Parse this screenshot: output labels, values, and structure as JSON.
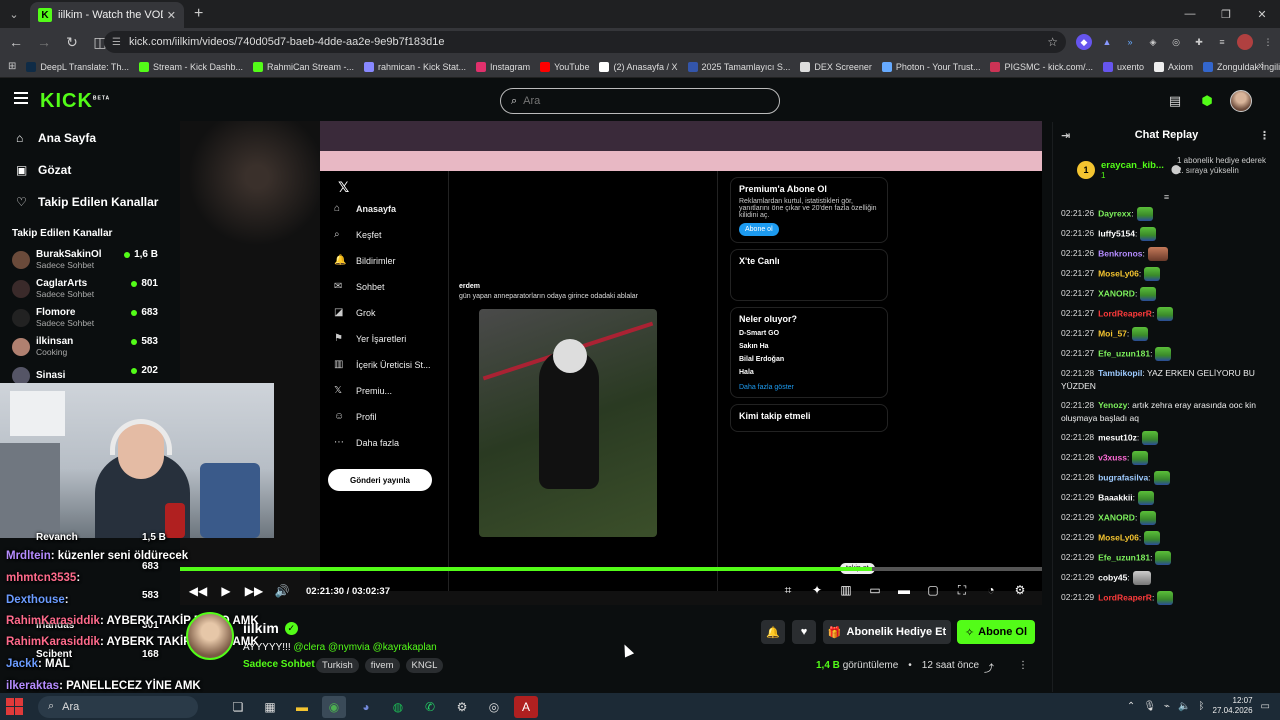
{
  "browser": {
    "tab_title": "iilkim - Watch the VOD on Kick",
    "tab_close": "✕",
    "new_tab": "+",
    "url": "kick.com/iilkim/videos/740d05d7-baeb-4dde-aa2e-9e9b7f183d1e",
    "bookmarks": [
      {
        "label": "DeepL Translate: Th...",
        "color": "#0f2b46"
      },
      {
        "label": "Stream - Kick Dashb...",
        "color": "#53fc18"
      },
      {
        "label": "RahmiCan Stream -...",
        "color": "#53fc18"
      },
      {
        "label": "rahmican - Kick Stat...",
        "color": "#8888ff"
      },
      {
        "label": "Instagram",
        "color": "#e1306c"
      },
      {
        "label": "YouTube",
        "color": "#ff0000"
      },
      {
        "label": "(2) Anasayfa / X",
        "color": "#ffffff"
      },
      {
        "label": "2025 Tamamlayıcı S...",
        "color": "#3355aa"
      },
      {
        "label": "DEX Screener",
        "color": "#dddddd"
      },
      {
        "label": "Photon - Your Trust...",
        "color": "#66aaff"
      },
      {
        "label": "PIGSMC - kick.com/...",
        "color": "#cc3355"
      },
      {
        "label": "uxento",
        "color": "#6655ee"
      },
      {
        "label": "Axiom",
        "color": "#eeeeee"
      },
      {
        "label": "Zonguldak İngilizce...",
        "color": "#3366cc"
      }
    ]
  },
  "kick": {
    "logo": "KICK",
    "logo_badge": "BETA",
    "search_placeholder": "Ara",
    "nav": [
      {
        "icon": "⌂",
        "label": "Ana Sayfa"
      },
      {
        "icon": "▣",
        "label": "Gözat"
      },
      {
        "icon": "♡",
        "label": "Takip Edilen Kanallar"
      }
    ],
    "followed_header": "Takip Edilen Kanallar",
    "followed": [
      {
        "name": "BurakSakinOl",
        "category": "Sadece Sohbet",
        "viewers": "1,6 B"
      },
      {
        "name": "CaglarArts",
        "category": "Sadece Sohbet",
        "viewers": "801"
      },
      {
        "name": "Flomore",
        "category": "Sadece Sohbet",
        "viewers": "683"
      },
      {
        "name": "ilkinsan",
        "category": "Cooking",
        "viewers": "583"
      },
      {
        "name": "Sinasi",
        "category": "",
        "viewers": "202"
      }
    ]
  },
  "video": {
    "time_current": "02:21:30",
    "time_sep": "/",
    "time_total": "03:02:37",
    "progress": 0.803,
    "chapter_tag": "takip et",
    "x_nav": [
      "Anasayfa",
      "Keşfet",
      "Bildirimler",
      "Sohbet",
      "Grok",
      "Yer İşaretleri",
      "İçerik Üreticisi St...",
      "Premiu...",
      "Profil",
      "Daha fazla"
    ],
    "x_post_btn": "Gönderi yayınla",
    "x_premium_title": "Premium'a Abone Ol",
    "x_premium_text": "Reklamlardan kurtul, istatistikleri gör, yanıtlarını öne çıkar ve 20'den fazla özelliğin kilidini aç.",
    "x_premium_btn": "Abone ol",
    "x_live_title": "X'te Canlı",
    "x_trends_title": "Neler oluyor?",
    "x_trends": [
      "D-Smart GO",
      "Sakın Ha",
      "Bilal Erdoğan",
      "Hala"
    ],
    "x_more": "Daha fazla göster",
    "x_who": "Kimi takip etmeli",
    "x_post_user": "erdem",
    "x_post_text": "gün yapan anneparatorların odaya girince odadaki ablalar"
  },
  "overlay_chat": [
    {
      "user": "Mrdltein",
      "text": ": küzenler seni öldürecek"
    },
    {
      "user": "mhmtcn3535",
      "text": ":"
    },
    {
      "user": "Dexthouse",
      "text": ":"
    },
    {
      "user": "RahimKarasiddik",
      "text": ": AYBERK TAKİP EDİYO AMK"
    },
    {
      "user": "RahimKarasiddik",
      "text": ": AYBERK TAKİP EDİYO AMK"
    },
    {
      "user": "Jackk",
      "text": ": MAL"
    },
    {
      "user": "ilkeraktas",
      "text": ": PANELLECEZ YİNE AMK"
    }
  ],
  "overlay_sidebar": [
    {
      "name": "Revanch",
      "viewers": "1,5 B"
    },
    {
      "name": "",
      "viewers": "683"
    },
    {
      "name": "",
      "viewers": "583"
    },
    {
      "name": "irlandas",
      "viewers": "301"
    },
    {
      "name": "Scibent",
      "viewers": "168"
    }
  ],
  "channel": {
    "name": "iilkim",
    "title_prefix": "AYYYYY!!!",
    "mentions": "@clera @nymvia @kayrakaplan",
    "category": "Sadece Sohbet",
    "tags": [
      "Turkish",
      "fivem",
      "KNGL"
    ],
    "gift_btn": "Abonelik Hediye Et",
    "sub_btn": "Abone Ol",
    "views": "1,4 B",
    "views_label": "görüntüleme",
    "dot": "•",
    "ago": "12 saat önce"
  },
  "chat": {
    "title": "Chat Replay",
    "pinned": {
      "rank": "1",
      "user": "eraycan_kib...",
      "sub": "1",
      "text": "1 abonelik hediye ederek 2. sıraya yükselin"
    },
    "messages": [
      {
        "ts": "02:21:26",
        "user": "Dayrexx",
        "color": "#7df05c",
        "text": "",
        "emote": "green"
      },
      {
        "ts": "02:21:26",
        "user": "luffy5154",
        "color": "#ffffff",
        "text": "",
        "emote": "green"
      },
      {
        "ts": "02:21:26",
        "user": "Benkronos",
        "color": "#b58cff",
        "text": "",
        "emote": "red"
      },
      {
        "ts": "02:21:27",
        "user": "MoseLy06",
        "color": "#f4c430",
        "text": "",
        "emote": "green"
      },
      {
        "ts": "02:21:27",
        "user": "XANORD",
        "color": "#7df05c",
        "text": "",
        "emote": "green"
      },
      {
        "ts": "02:21:27",
        "user": "LordReaperR",
        "color": "#ff3b3b",
        "text": "",
        "emote": "green"
      },
      {
        "ts": "02:21:27",
        "user": "Moi_57",
        "color": "#f4c430",
        "text": "",
        "emote": "green"
      },
      {
        "ts": "02:21:27",
        "user": "Efe_uzun181",
        "color": "#7df05c",
        "text": "",
        "emote": "green"
      },
      {
        "ts": "02:21:28",
        "user": "Tambikopil",
        "color": "#9ecbff",
        "text": "YAZ ERKEN GELİYORU BU YÜZDEN",
        "emote": ""
      },
      {
        "ts": "02:21:28",
        "user": "Yenozy",
        "color": "#7df05c",
        "text": "artık zehra eray arasında ooc kin oluşmaya başladı aq",
        "emote": ""
      },
      {
        "ts": "02:21:28",
        "user": "mesut10z",
        "color": "#ffffff",
        "text": "",
        "emote": "green"
      },
      {
        "ts": "02:21:28",
        "user": "v3xuss",
        "color": "#ff6bd6",
        "text": "",
        "emote": "green"
      },
      {
        "ts": "02:21:28",
        "user": "bugrafasilva",
        "color": "#9ecbff",
        "text": "",
        "emote": "green"
      },
      {
        "ts": "02:21:29",
        "user": "Baaakkii",
        "color": "#ffffff",
        "text": "",
        "emote": "green"
      },
      {
        "ts": "02:21:29",
        "user": "XANORD",
        "color": "#7df05c",
        "text": "",
        "emote": "green"
      },
      {
        "ts": "02:21:29",
        "user": "MoseLy06",
        "color": "#f4c430",
        "text": "",
        "emote": "green"
      },
      {
        "ts": "02:21:29",
        "user": "Efe_uzun181",
        "color": "#7df05c",
        "text": "",
        "emote": "green"
      },
      {
        "ts": "02:21:29",
        "user": "coby45",
        "color": "#ffffff",
        "text": "",
        "emote": "grey"
      },
      {
        "ts": "02:21:29",
        "user": "LordReaperR",
        "color": "#ff3b3b",
        "text": "",
        "emote": "green"
      }
    ]
  },
  "taskbar": {
    "search": "Ara",
    "time": "12:07",
    "date": "27.04.2026"
  }
}
